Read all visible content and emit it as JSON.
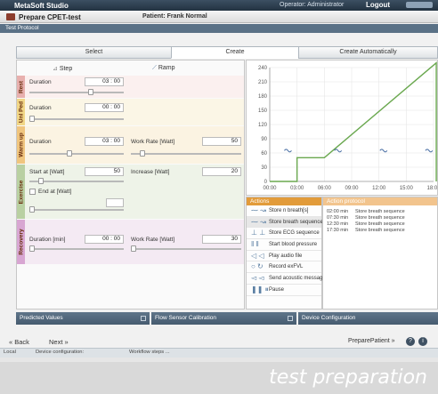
{
  "app": {
    "title": "MetaSoft Studio",
    "operator": "Operator: Administrator",
    "logout": "Logout"
  },
  "subheader": {
    "title": "Prepare CPET-test",
    "patient": "Patient:  Frank Normal"
  },
  "section_title": "Test Protocol",
  "tabs": [
    "Select",
    "Create",
    "Create Automatically"
  ],
  "shape_options": {
    "step": "Step",
    "ramp": "Ramp"
  },
  "phases": {
    "rest": {
      "band": "Rest",
      "duration_label": "Duration",
      "duration_value": "03 : 00",
      "slider_level": 0.62
    },
    "unloaded": {
      "band": "Unl Ped",
      "duration_label": "Duration",
      "duration_value": "00 : 00",
      "slider_level": 0.0
    },
    "warmup": {
      "band": "Warm up",
      "duration_label": "Duration",
      "duration_value": "03 : 00",
      "work_label": "Work Rate [Watt]",
      "work_value": "50",
      "slider_level": 0.4,
      "work_slider_level": 0.08
    },
    "exercise": {
      "band": "Exercise",
      "start_label": "Start at [Watt]",
      "start_value": "50",
      "increase_label": "Increase [Watt]",
      "increase_value": "20",
      "end_label": "End at [Watt]",
      "slider_level": 0.1
    },
    "recovery": {
      "band": "Recovery",
      "duration_label": "Duration [min]",
      "duration_value": "00 : 00",
      "work_label": "Work Rate [Watt]",
      "work_value": "30",
      "slider_level": 0.0
    }
  },
  "chart_data": {
    "type": "line",
    "x": [
      "00:00",
      "03:00",
      "06:00",
      "09:00",
      "12:00",
      "15:00",
      "18:00"
    ],
    "y_ticks": [
      0,
      30,
      60,
      90,
      120,
      150,
      180,
      210,
      240
    ],
    "ylim": [
      0,
      240
    ],
    "series": [
      {
        "values_min": [
          0,
          3,
          3,
          6,
          6,
          18.3,
          18.3
        ],
        "values_watt": [
          0,
          0,
          50,
          50,
          50,
          250,
          0
        ]
      }
    ],
    "colors": {
      "line": "#6aa84f",
      "marker": "#4a6fa5"
    }
  },
  "actions": {
    "header": "Actions",
    "items": [
      "Store n breath[s]",
      "Store breath sequence",
      "Store ECG sequence",
      "Start blood pressure",
      "Play audio file",
      "Record exFVL",
      "Send acoustic message",
      "Pause"
    ]
  },
  "protocol": {
    "header": "Action protocol",
    "rows": [
      {
        "time": "02:00 min",
        "event": "Store breath sequence"
      },
      {
        "time": "07:30 min",
        "event": "Store breath sequence"
      },
      {
        "time": "12:30 min",
        "event": "Store breath sequence"
      },
      {
        "time": "17:30 min",
        "event": "Store breath sequence"
      }
    ]
  },
  "bottom_panels": [
    "Predicted Values",
    "Flow Sensor Calibration",
    "Device Configuration"
  ],
  "nav": {
    "back": "« Back",
    "next": "Next »",
    "prepare": "PreparePatient »"
  },
  "status": {
    "local": "Local",
    "device": "Device configuration:",
    "workflow": "Workflow steps ..."
  },
  "caption": "test preparation"
}
